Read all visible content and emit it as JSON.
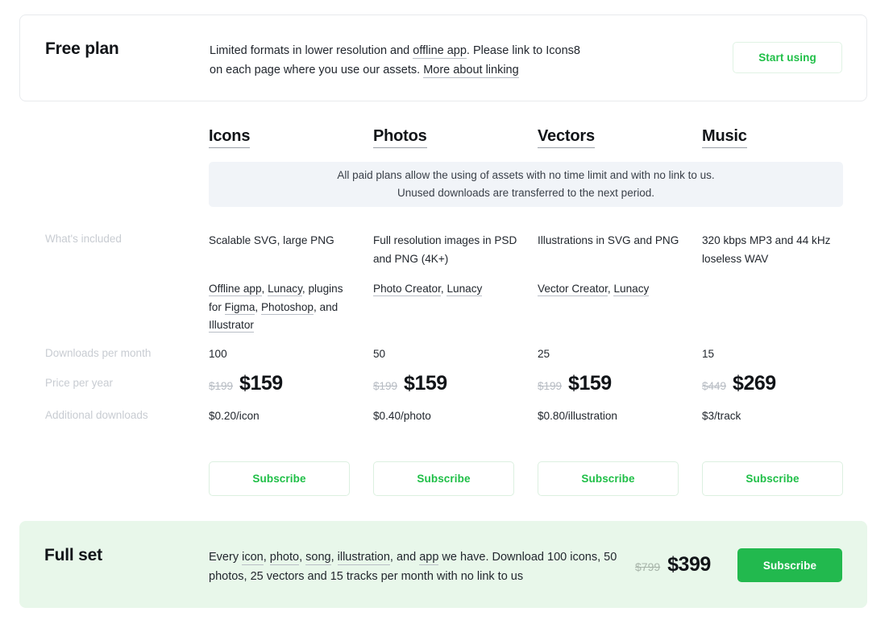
{
  "free_plan": {
    "title": "Free plan",
    "description_parts": [
      {
        "text": "Limited formats in lower resolution and ",
        "link": false
      },
      {
        "text": "offline app",
        "link": true
      },
      {
        "text": ". Please link to Icons8 on each page where you use our assets. ",
        "link": false
      },
      {
        "text": "More about linking",
        "link": true
      }
    ],
    "description_plain": "Limited formats in lower resolution and offline app. Please link to Icons8 on each page where you use our assets. More about linking",
    "cta_label": "Start using"
  },
  "banner": {
    "line1": "All paid plans allow the using of assets with no time limit and with no link to us.",
    "line2": "Unused downloads are transferred to the next period."
  },
  "row_labels": {
    "included": "What's included",
    "downloads": "Downloads per month",
    "price": "Price per year",
    "additional": "Additional downloads"
  },
  "columns": [
    {
      "name": "Icons",
      "features": "Scalable SVG, large PNG",
      "tools_parts": [
        {
          "text": "Offline app",
          "link": true
        },
        {
          "text": ", ",
          "link": false
        },
        {
          "text": "Lunacy",
          "link": true
        },
        {
          "text": ", plugins for ",
          "link": false
        },
        {
          "text": "Figma",
          "link": true
        },
        {
          "text": ", ",
          "link": false
        },
        {
          "text": "Photoshop",
          "link": true
        },
        {
          "text": ", and ",
          "link": false
        },
        {
          "text": "Illustrator",
          "link": true
        }
      ],
      "tools_plain": "Offline app, Lunacy, plugins for Figma, Photoshop, and Illustrator",
      "downloads": "100",
      "price_old": "$199",
      "price_new": "$159",
      "additional": "$0.20/icon",
      "subscribe_label": "Subscribe"
    },
    {
      "name": "Photos",
      "features": "Full resolution images in PSD and PNG (4K+)",
      "tools_parts": [
        {
          "text": "Photo Creator",
          "link": true
        },
        {
          "text": ", ",
          "link": false
        },
        {
          "text": "Lunacy",
          "link": true
        }
      ],
      "tools_plain": "Photo Creator, Lunacy",
      "downloads": "50",
      "price_old": "$199",
      "price_new": "$159",
      "additional": "$0.40/photo",
      "subscribe_label": "Subscribe"
    },
    {
      "name": "Vectors",
      "features": "Illustrations in SVG and PNG",
      "tools_parts": [
        {
          "text": "Vector Creator",
          "link": true
        },
        {
          "text": ", ",
          "link": false
        },
        {
          "text": "Lunacy",
          "link": true
        }
      ],
      "tools_plain": "Vector Creator, Lunacy",
      "downloads": "25",
      "price_old": "$199",
      "price_new": "$159",
      "additional": "$0.80/illustration",
      "subscribe_label": "Subscribe"
    },
    {
      "name": "Music",
      "features": "320 kbps MP3 and 44 kHz loseless WAV",
      "tools_parts": [],
      "tools_plain": "",
      "downloads": "15",
      "price_old": "$449",
      "price_new": "$269",
      "additional": "$3/track",
      "subscribe_label": "Subscribe"
    }
  ],
  "full_set": {
    "title": "Full set",
    "description_parts": [
      {
        "text": "Every ",
        "link": false
      },
      {
        "text": "icon",
        "link": true
      },
      {
        "text": ", ",
        "link": false
      },
      {
        "text": "photo",
        "link": true
      },
      {
        "text": ", ",
        "link": false
      },
      {
        "text": "song",
        "link": true
      },
      {
        "text": ", ",
        "link": false
      },
      {
        "text": "illustration",
        "link": true
      },
      {
        "text": ", and ",
        "link": false
      },
      {
        "text": "app",
        "link": true
      },
      {
        "text": " we have. Download 100 icons, 50 photos, 25 vectors and 15 tracks per month with no link to us",
        "link": false
      }
    ],
    "description_plain": "Every icon, photo, song, illustration, and app we have. Download 100 icons, 50 photos, 25 vectors and 15 tracks per month with no link to us",
    "price_old": "$799",
    "price_new": "$399",
    "cta_label": "Subscribe"
  },
  "colors": {
    "accent_green": "#22b94e",
    "link_green": "#1fbf47",
    "banner_bg": "#f1f4f8",
    "fullset_bg": "#e8f7ea",
    "label_gray": "#c8ccd2"
  }
}
